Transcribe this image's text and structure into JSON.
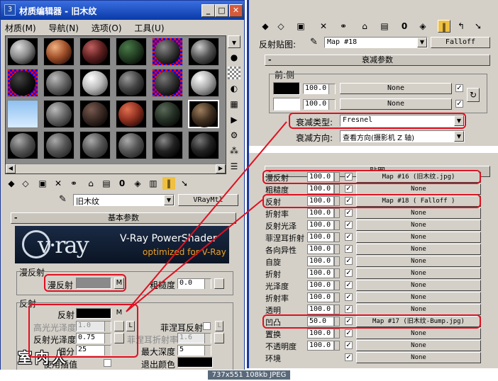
{
  "left_window": {
    "title": "材质编辑器 - 旧木纹",
    "menu": [
      "材质(M)",
      "导航(N)",
      "选项(O)",
      "工具(U)"
    ],
    "material_name": "旧木纹",
    "material_type": "VRayMtl",
    "basic_params_title": "基本参数",
    "vray_logo": "v·ray",
    "vray_line1": "V-Ray PowerShader",
    "vray_line2": "optimized for V-Ray",
    "diffuse_group": "漫反射",
    "diffuse_label": "漫反射",
    "diffuse_m": "M",
    "roughness_label": "粗糙度",
    "roughness_value": "0.0",
    "reflect_group": "反射",
    "reflect_label": "反射",
    "reflect_m": "M",
    "hilight_gloss_label": "高光光泽度",
    "hilight_gloss_value": "1.0",
    "hilight_l": "L",
    "fresnel_label": "菲涅耳反射",
    "fresnel_l": "L",
    "refl_gloss_label": "反射光泽度",
    "refl_gloss_value": "0.75",
    "fresnel_ior_label": "菲涅耳折射率",
    "fresnel_ior_value": "1.6",
    "subdivs_label": "细分",
    "subdivs_value": "25",
    "max_depth_label": "最大深度",
    "max_depth_value": "5",
    "use_interp_label": "使用插值",
    "exit_color_label": "退出颜色",
    "watermark": "室内人"
  },
  "right_window": {
    "reflect_map_label": "反射贴图:",
    "reflect_map_name": "Map #18",
    "reflect_map_type": "Falloff",
    "falloff_title": "衰减参数",
    "front_side_label": "前:侧",
    "slot1_value": "100.0",
    "slot1_map": "None",
    "slot2_value": "100.0",
    "slot2_map": "None",
    "falloff_type_label": "衰减类型:",
    "falloff_type_value": "Fresnel",
    "falloff_dir_label": "衰减方向:",
    "falloff_dir_value": "查看方向(摄影机 Z 轴)",
    "maps_title": "贴图",
    "maps": [
      {
        "label": "漫反射",
        "value": "100.0",
        "map": "Map #16 (旧木纹.jpg)"
      },
      {
        "label": "粗糙度",
        "value": "100.0",
        "map": "None"
      },
      {
        "label": "反射",
        "value": "100.0",
        "map": "Map #18  ( Falloff )"
      },
      {
        "label": "折射率",
        "value": "100.0",
        "map": "None"
      },
      {
        "label": "反射光泽",
        "value": "100.0",
        "map": "None"
      },
      {
        "label": "菲涅耳折射",
        "value": "100.0",
        "map": "None"
      },
      {
        "label": "各向异性",
        "value": "100.0",
        "map": "None"
      },
      {
        "label": "自旋",
        "value": "100.0",
        "map": "None"
      },
      {
        "label": "折射",
        "value": "100.0",
        "map": "None"
      },
      {
        "label": "光泽度",
        "value": "100.0",
        "map": "None"
      },
      {
        "label": "折射率",
        "value": "100.0",
        "map": "None"
      },
      {
        "label": "透明",
        "value": "100.0",
        "map": "None"
      },
      {
        "label": "凹凸",
        "value": "50.0",
        "map": "Map #17 (旧木纹-Bump.jpg)"
      },
      {
        "label": "置换",
        "value": "100.0",
        "map": "None"
      },
      {
        "label": "不透明度",
        "value": "100.0",
        "map": "None"
      },
      {
        "label": "环境",
        "value": "",
        "map": "None"
      }
    ]
  },
  "footer": {
    "caption": "737x551  108kb  JPEG"
  },
  "colors": {
    "title_bar": "#0a246a",
    "annotation": "#e01020",
    "face": "#d4d0c8"
  }
}
